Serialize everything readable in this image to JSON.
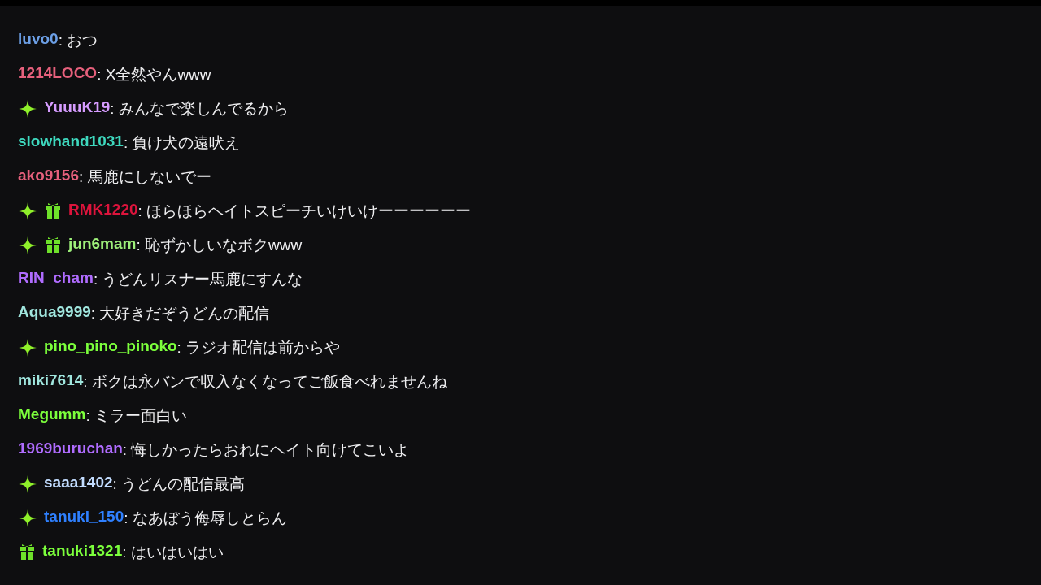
{
  "messages": [
    {
      "user": "luvo0",
      "color": "#6c9fe6",
      "sparkle": false,
      "gift": false,
      "text": ": おつ"
    },
    {
      "user": "1214LOCO",
      "color": "#e6607c",
      "sparkle": false,
      "gift": false,
      "text": ": X全然やんwww"
    },
    {
      "user": "YuuuK19",
      "color": "#d69cff",
      "sparkle": true,
      "gift": false,
      "text": ": みんなで楽しんでるから"
    },
    {
      "user": "slowhand1031",
      "color": "#3ed8be",
      "sparkle": false,
      "gift": false,
      "text": ": 負け犬の遠吠え"
    },
    {
      "user": "ako9156",
      "color": "#e6607c",
      "sparkle": false,
      "gift": false,
      "text": ": 馬鹿にしないでー"
    },
    {
      "user": "RMK1220",
      "color": "#dc143c",
      "sparkle": true,
      "gift": true,
      "text": ": ほらほらヘイトスピーチいけいけーーーーーー"
    },
    {
      "user": "jun6mam",
      "color": "#9ef07a",
      "sparkle": true,
      "gift": true,
      "text": ": 恥ずかしいなボクwww"
    },
    {
      "user": "RIN_cham",
      "color": "#b06cff",
      "sparkle": false,
      "gift": false,
      "text": ": うどんリスナー馬鹿にすんな"
    },
    {
      "user": "Aqua9999",
      "color": "#a0e6de",
      "sparkle": false,
      "gift": false,
      "text": ": 大好きだぞうどんの配信"
    },
    {
      "user": "pino_pino_pinoko",
      "color": "#7cff3c",
      "sparkle": true,
      "gift": false,
      "text": ": ラジオ配信は前からや"
    },
    {
      "user": "miki7614",
      "color": "#a0e6de",
      "sparkle": false,
      "gift": false,
      "text": ": ボクは永バンで収入なくなってご飯食べれませんね"
    },
    {
      "user": "Megumm",
      "color": "#7cff3c",
      "sparkle": false,
      "gift": false,
      "text": ": ミラー面白い"
    },
    {
      "user": "1969buruchan",
      "color": "#b06cff",
      "sparkle": false,
      "gift": false,
      "text": ": 悔しかったらおれにヘイト向けてこいよ"
    },
    {
      "user": "saaa1402",
      "color": "#c2dcff",
      "sparkle": true,
      "gift": false,
      "text": ": うどんの配信最高"
    },
    {
      "user": "tanuki_150",
      "color": "#2f80ff",
      "sparkle": true,
      "gift": false,
      "text": ": なあぼう侮辱しとらん"
    },
    {
      "user": "tanuki1321",
      "color": "#7cff3c",
      "sparkle": false,
      "gift": true,
      "text": ": はいはいはい"
    }
  ]
}
